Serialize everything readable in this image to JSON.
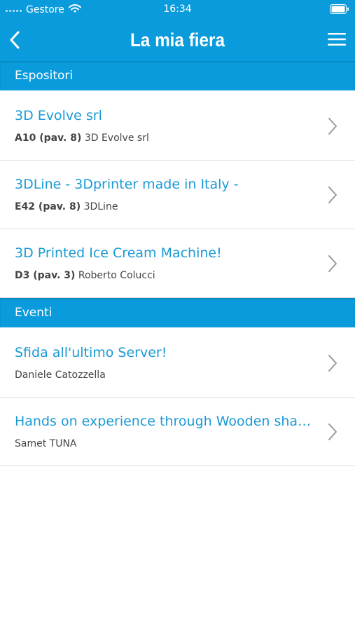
{
  "status_bar": {
    "carrier": "Gestore",
    "time": "16:34"
  },
  "navbar": {
    "title": "La mia fiera",
    "back_icon": "chevron-left-icon",
    "menu_icon": "hamburger-menu-icon"
  },
  "colors": {
    "brand": "#0a9bdc",
    "link": "#1a9ad6"
  },
  "sections": {
    "exhibitors": {
      "title": "Espositori",
      "items": [
        {
          "title": "3D Evolve srl",
          "stand": "A10 (pav. 8)",
          "company": "3D Evolve srl"
        },
        {
          "title": "3DLine - 3Dprinter made in Italy -",
          "stand": "E42 (pav. 8)",
          "company": "3DLine"
        },
        {
          "title": "3D Printed Ice Cream Machine!",
          "stand": "D3 (pav. 3)",
          "company": "Roberto Colucci"
        }
      ]
    },
    "events": {
      "title": "Eventi",
      "items": [
        {
          "title": "Sfida all'ultimo Server!",
          "speaker": "Daniele Catozzella"
        },
        {
          "title": "Hands on experience through Wooden shap…",
          "speaker": "Samet TUNA"
        }
      ]
    }
  }
}
